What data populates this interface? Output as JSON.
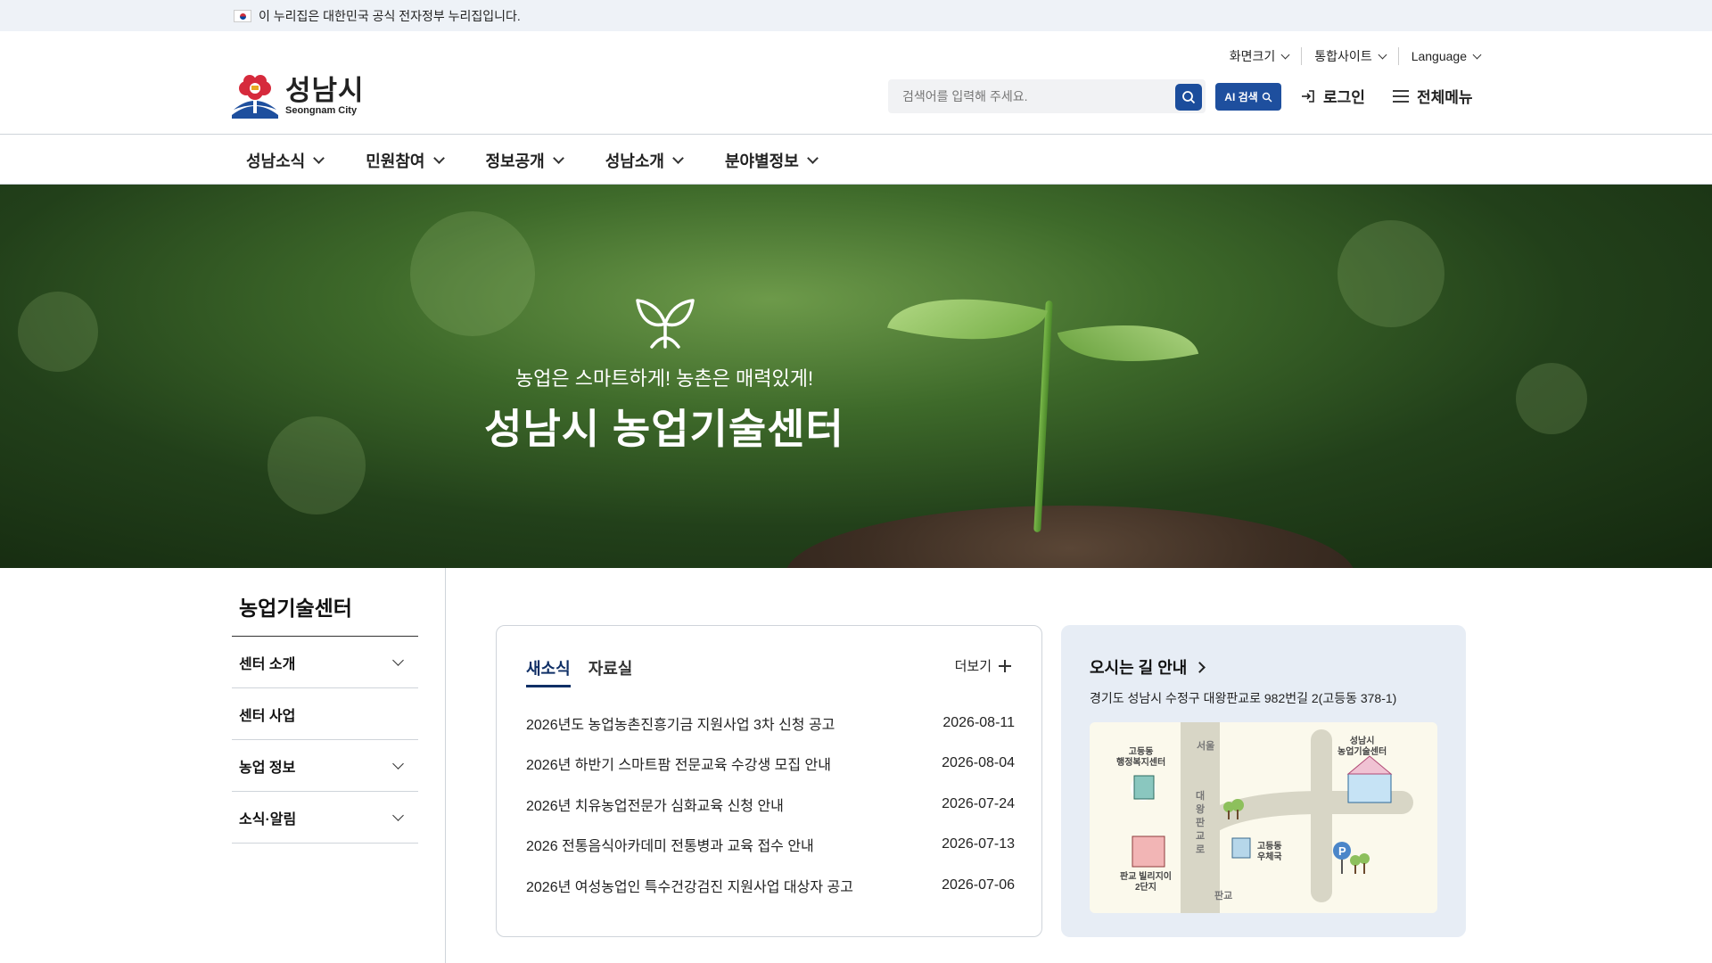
{
  "gov_banner": {
    "text": "이 누리집은 대한민국 공식 전자정부 누리집입니다."
  },
  "logo": {
    "ko": "성남시",
    "en": "Seongnam City"
  },
  "utility": {
    "font_size": "화면크기",
    "integrated_site": "통합사이트",
    "language": "Language"
  },
  "search": {
    "placeholder": "검색어를 입력해 주세요.",
    "ai_label": "AI 검색"
  },
  "header": {
    "login": "로그인",
    "all_menu": "전체메뉴"
  },
  "gnb": [
    "성남소식",
    "민원참여",
    "정보공개",
    "성남소개",
    "분야별정보"
  ],
  "hero": {
    "subtitle": "농업은 스마트하게! 농촌은 매력있게!",
    "title": "성남시 농업기술센터"
  },
  "sidebar": {
    "title": "농업기술센터",
    "items": [
      {
        "label": "센터 소개",
        "expandable": true
      },
      {
        "label": "센터 사업",
        "expandable": false
      },
      {
        "label": "농업 정보",
        "expandable": true
      },
      {
        "label": "소식·알림",
        "expandable": true
      }
    ]
  },
  "news": {
    "tabs": [
      "새소식",
      "자료실"
    ],
    "more": "더보기",
    "items": [
      {
        "title": "2026년도 농업농촌진흥기금 지원사업 3차 신청 공고",
        "date": "2026-08-11"
      },
      {
        "title": "2026년 하반기 스마트팜 전문교육 수강생 모집 안내",
        "date": "2026-08-04"
      },
      {
        "title": "2026년 치유농업전문가 심화교육 신청 안내",
        "date": "2026-07-24"
      },
      {
        "title": "2026 전통음식아카데미 전통병과 교육 접수 안내",
        "date": "2026-07-13"
      },
      {
        "title": "2026년 여성농업인 특수건강검진 지원사업 대상자 공고",
        "date": "2026-07-06"
      }
    ]
  },
  "directions": {
    "title": "오시는 길 안내",
    "address": "경기도 성남시 수정구 대왕판교로 982번길 2(고등동 378-1)",
    "map_labels": {
      "office": "고등동\n행정복지센터",
      "center": "성남시\n농업기술센터",
      "apartment": "판교 빌리지이\n2단지",
      "post": "고등동\n우체국",
      "road": "대\n왕\n판\n교\n로",
      "seoul": "서울",
      "pangyo": "판교"
    }
  },
  "colors": {
    "primary": "#1b4d9c",
    "tab_active": "#0f2f66",
    "map_bg": "#e7edf5"
  }
}
